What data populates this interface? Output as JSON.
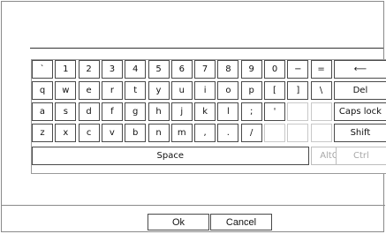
{
  "keyboard": {
    "rows": [
      [
        "`",
        "1",
        "2",
        "3",
        "4",
        "5",
        "6",
        "7",
        "8",
        "9",
        "0",
        "−",
        "=",
        "⟵"
      ],
      [
        "q",
        "w",
        "e",
        "r",
        "t",
        "y",
        "u",
        "i",
        "o",
        "p",
        "[",
        "]",
        "\\",
        "Del"
      ],
      [
        "a",
        "s",
        "d",
        "f",
        "g",
        "h",
        "j",
        "k",
        "l",
        ";",
        "'",
        "",
        "",
        "Caps lock"
      ],
      [
        "z",
        "x",
        "c",
        "v",
        "b",
        "n",
        "m",
        ",",
        ".",
        "/",
        "",
        "",
        "",
        "Shift"
      ]
    ],
    "space_label": "Space",
    "altgr_label": "AltGr",
    "ctrl_label": "Ctrl"
  },
  "footer": {
    "ok_label": "Ok",
    "cancel_label": "Cancel"
  }
}
